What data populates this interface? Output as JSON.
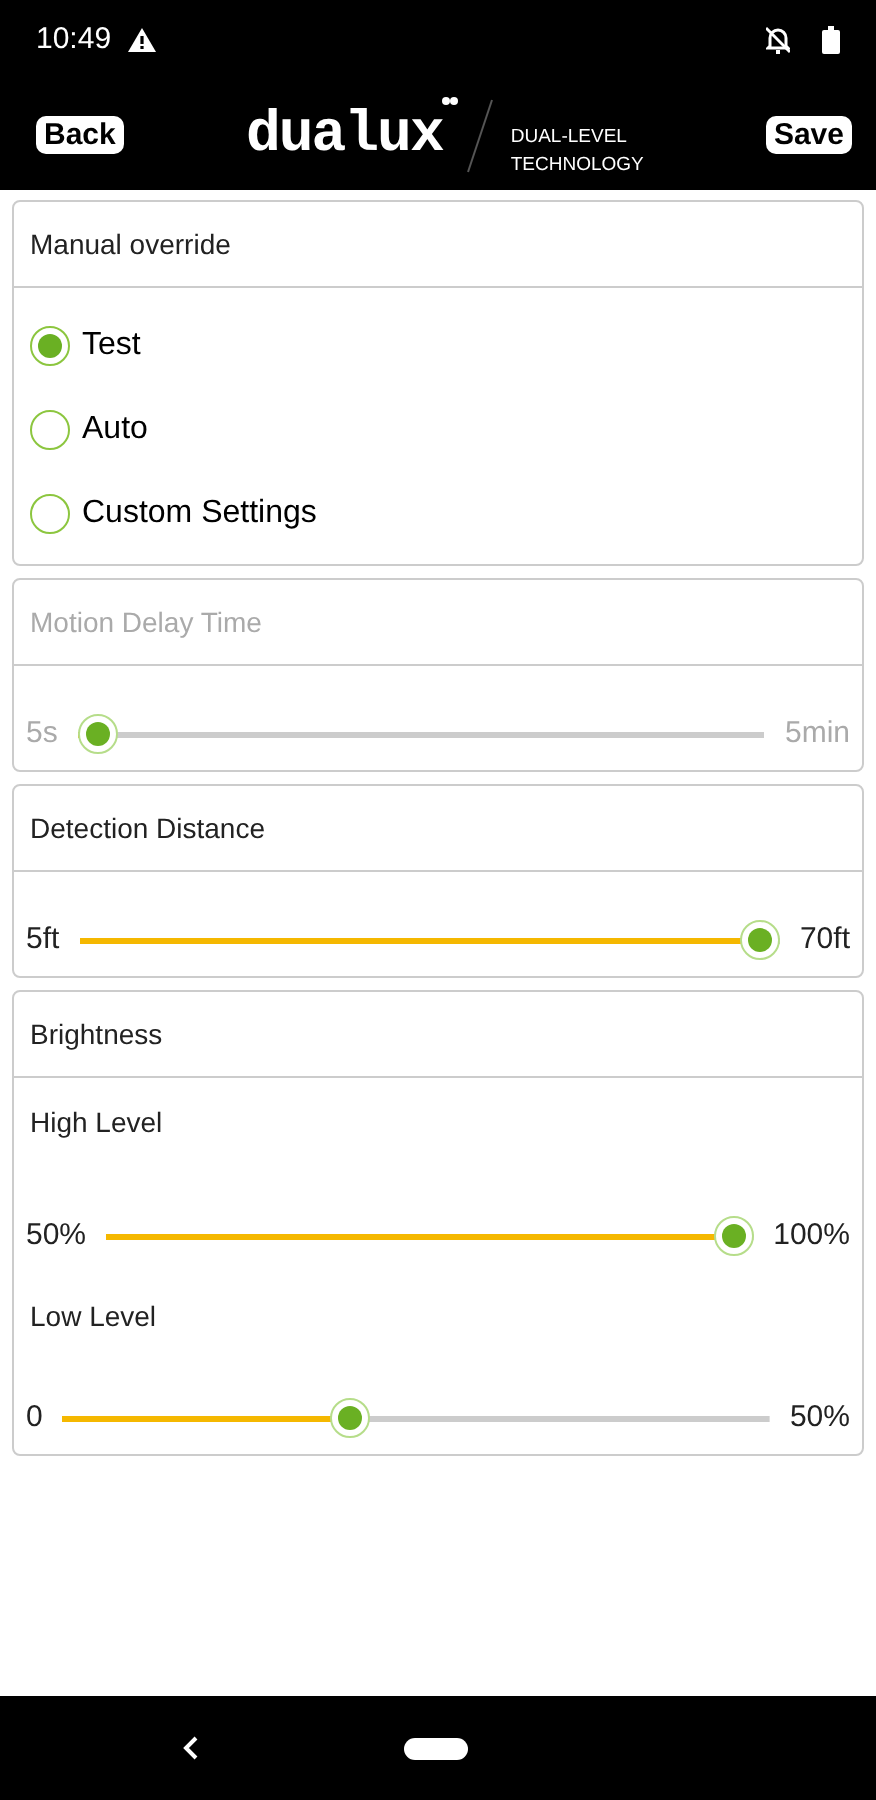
{
  "status_bar": {
    "time": "10:49"
  },
  "header": {
    "back": "Back",
    "logo": "dualux",
    "tagline": [
      "DUAL-LEVEL",
      "TECHNOLOGY"
    ],
    "save": "Save"
  },
  "cards": [
    {
      "kind": "radio",
      "title": "Manual override",
      "disabled": false,
      "options": [
        {
          "label": "Test",
          "selected": true
        },
        {
          "label": "Auto",
          "selected": false
        },
        {
          "label": "Custom Settings",
          "selected": false
        }
      ]
    },
    {
      "kind": "slider",
      "title": "Motion Delay Time",
      "disabled": true,
      "sliders": [
        {
          "min": "5s",
          "max": "5min",
          "level": 0
        }
      ]
    },
    {
      "kind": "slider",
      "title": "Detection Distance",
      "disabled": false,
      "sliders": [
        {
          "min": "5ft",
          "max": "70ft",
          "level": 1
        }
      ]
    },
    {
      "kind": "slider",
      "title": "Brightness",
      "disabled": false,
      "sliders": [
        {
          "label": "High Level",
          "min": "50%",
          "max": "100%",
          "level": 1
        },
        {
          "label": "Low Level",
          "min": "0",
          "max": "50%",
          "level": 0.4
        }
      ]
    }
  ]
}
